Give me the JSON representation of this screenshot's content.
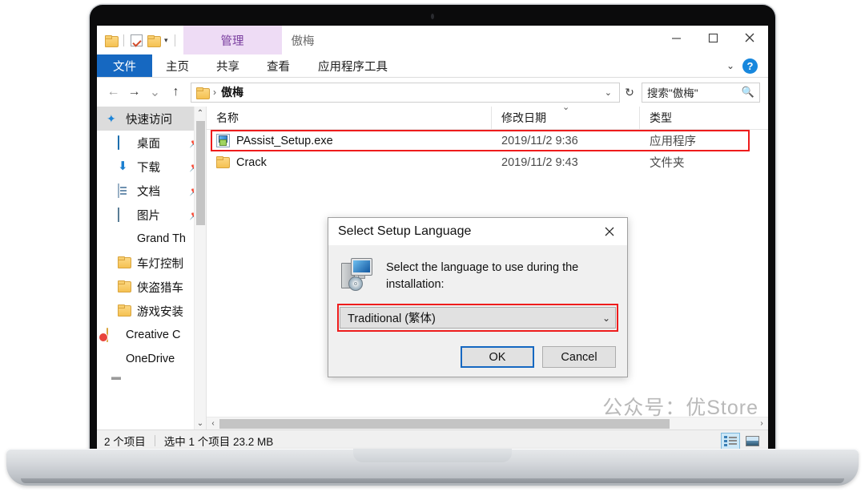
{
  "window": {
    "title": "傲梅",
    "minimize_label": "—",
    "maximize_label": "□",
    "close_label": "✕"
  },
  "quick_access_toolbar": {
    "icons": [
      "folder-icon",
      "checkbox-checked-icon",
      "folder-icon",
      "dropdown-caret-icon"
    ]
  },
  "ribbon": {
    "contextual_tab": "管理",
    "tabs": [
      {
        "label": "文件",
        "active": true
      },
      {
        "label": "主页",
        "active": false
      },
      {
        "label": "共享",
        "active": false
      },
      {
        "label": "查看",
        "active": false
      },
      {
        "label": "应用程序工具",
        "active": false
      }
    ],
    "collapse_icon": "chevron-down-icon",
    "help_label": "?"
  },
  "address_bar": {
    "back_label": "←",
    "forward_label": "→",
    "recent_label": "⌄",
    "up_label": "↑",
    "breadcrumb_icon": "folder-icon",
    "breadcrumb_separator": "›",
    "breadcrumb_path": "傲梅",
    "dropdown_label": "⌄",
    "refresh_label": "↻"
  },
  "search": {
    "placeholder": "搜索\"傲梅\"",
    "icon": "search-icon"
  },
  "sidebar": {
    "items": [
      {
        "label": "快速访问",
        "icon": "star-icon",
        "selected": true,
        "indent": false,
        "pinned": false
      },
      {
        "label": "桌面",
        "icon": "desktop-icon",
        "selected": false,
        "indent": true,
        "pinned": true
      },
      {
        "label": "下载",
        "icon": "download-icon",
        "selected": false,
        "indent": true,
        "pinned": true
      },
      {
        "label": "文档",
        "icon": "document-icon",
        "selected": false,
        "indent": true,
        "pinned": true
      },
      {
        "label": "图片",
        "icon": "picture-icon",
        "selected": false,
        "indent": true,
        "pinned": true
      },
      {
        "label": "Grand Th",
        "icon": "game-icon",
        "selected": false,
        "indent": true,
        "pinned": false
      },
      {
        "label": "车灯控制",
        "icon": "folder-icon",
        "selected": false,
        "indent": true,
        "pinned": false
      },
      {
        "label": "侠盗猎车",
        "icon": "folder-icon",
        "selected": false,
        "indent": true,
        "pinned": false
      },
      {
        "label": "游戏安装",
        "icon": "folder-icon",
        "selected": false,
        "indent": true,
        "pinned": false
      },
      {
        "label": "Creative C",
        "icon": "creative-cloud-icon",
        "selected": false,
        "indent": false,
        "pinned": false
      },
      {
        "label": "OneDrive",
        "icon": "onedrive-icon",
        "selected": false,
        "indent": false,
        "pinned": false
      }
    ],
    "pin_glyph": "📌",
    "scroll_up": "⌃",
    "scroll_down": "⌄"
  },
  "file_list": {
    "columns": [
      "名称",
      "修改日期",
      "类型"
    ],
    "sort_marker": "⌄",
    "rows": [
      {
        "name": "PAssist_Setup.exe",
        "date": "2019/11/2 9:36",
        "type": "应用程序",
        "icon": "exe-installer-icon",
        "highlighted": true
      },
      {
        "name": "Crack",
        "date": "2019/11/2 9:43",
        "type": "文件夹",
        "icon": "folder-icon",
        "highlighted": false
      }
    ],
    "highlight_color": "#ee1c1c"
  },
  "watermark": "公众号：优Store",
  "h_scrollbar": {
    "left_arrow": "‹",
    "right_arrow": "›"
  },
  "status_bar": {
    "item_count": "2 个项目",
    "selection": "选中 1 个项目  23.2 MB",
    "views": [
      {
        "name": "details-view-button",
        "selected": true
      },
      {
        "name": "large-icons-view-button",
        "selected": false
      }
    ]
  },
  "dialog": {
    "title": "Select Setup Language",
    "close_label": "✕",
    "icon": "setup-installer-icon",
    "message": "Select the language to use during the installation:",
    "select_value": "Traditional (繁体)",
    "select_caret": "⌄",
    "select_highlight_color": "#ee1c1c",
    "ok_label": "OK",
    "cancel_label": "Cancel"
  }
}
